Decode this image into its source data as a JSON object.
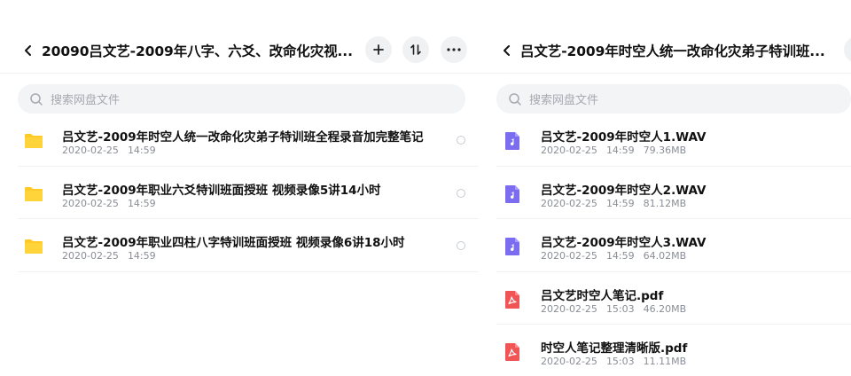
{
  "left": {
    "title": "20090吕文艺-2009年八字、六爻、改命化灾视...",
    "search_placeholder": "搜索网盘文件",
    "items": [
      {
        "name": "吕文艺-2009年时空人统一改命化灾弟子特训班全程录音加完整笔记",
        "date": "2020-02-25",
        "time": "14:59",
        "size": ""
      },
      {
        "name": "吕文艺-2009年职业六爻特训班面授班 视频录像5讲14小时",
        "date": "2020-02-25",
        "time": "14:59",
        "size": ""
      },
      {
        "name": "吕文艺-2009年职业四柱八字特训班面授班 视频录像6讲18小时",
        "date": "2020-02-25",
        "time": "14:59",
        "size": ""
      }
    ]
  },
  "right": {
    "title": "吕文艺-2009年时空人统一改命化灾弟子特训班...",
    "search_placeholder": "搜索网盘文件",
    "items": [
      {
        "name": "吕文艺-2009年时空人1.WAV",
        "date": "2020-02-25",
        "time": "14:59",
        "size": "79.36MB",
        "kind": "audio"
      },
      {
        "name": "吕文艺-2009年时空人2.WAV",
        "date": "2020-02-25",
        "time": "14:59",
        "size": "81.12MB",
        "kind": "audio"
      },
      {
        "name": "吕文艺-2009年时空人3.WAV",
        "date": "2020-02-25",
        "time": "14:59",
        "size": "64.02MB",
        "kind": "audio"
      },
      {
        "name": "吕文艺时空人笔记.pdf",
        "date": "2020-02-25",
        "time": "15:03",
        "size": "46.20MB",
        "kind": "pdf"
      },
      {
        "name": "时空人笔记整理清晰版.pdf",
        "date": "2020-02-25",
        "time": "15:03",
        "size": "11.11MB",
        "kind": "pdf"
      }
    ]
  },
  "colors": {
    "folder": "#ffc928",
    "audio": "#7b6cf0",
    "pdf": "#f05454"
  },
  "icons": {
    "back": "chevron-left-icon",
    "add": "plus-icon",
    "sort": "sort-icon",
    "more": "more-icon",
    "search": "search-icon"
  }
}
